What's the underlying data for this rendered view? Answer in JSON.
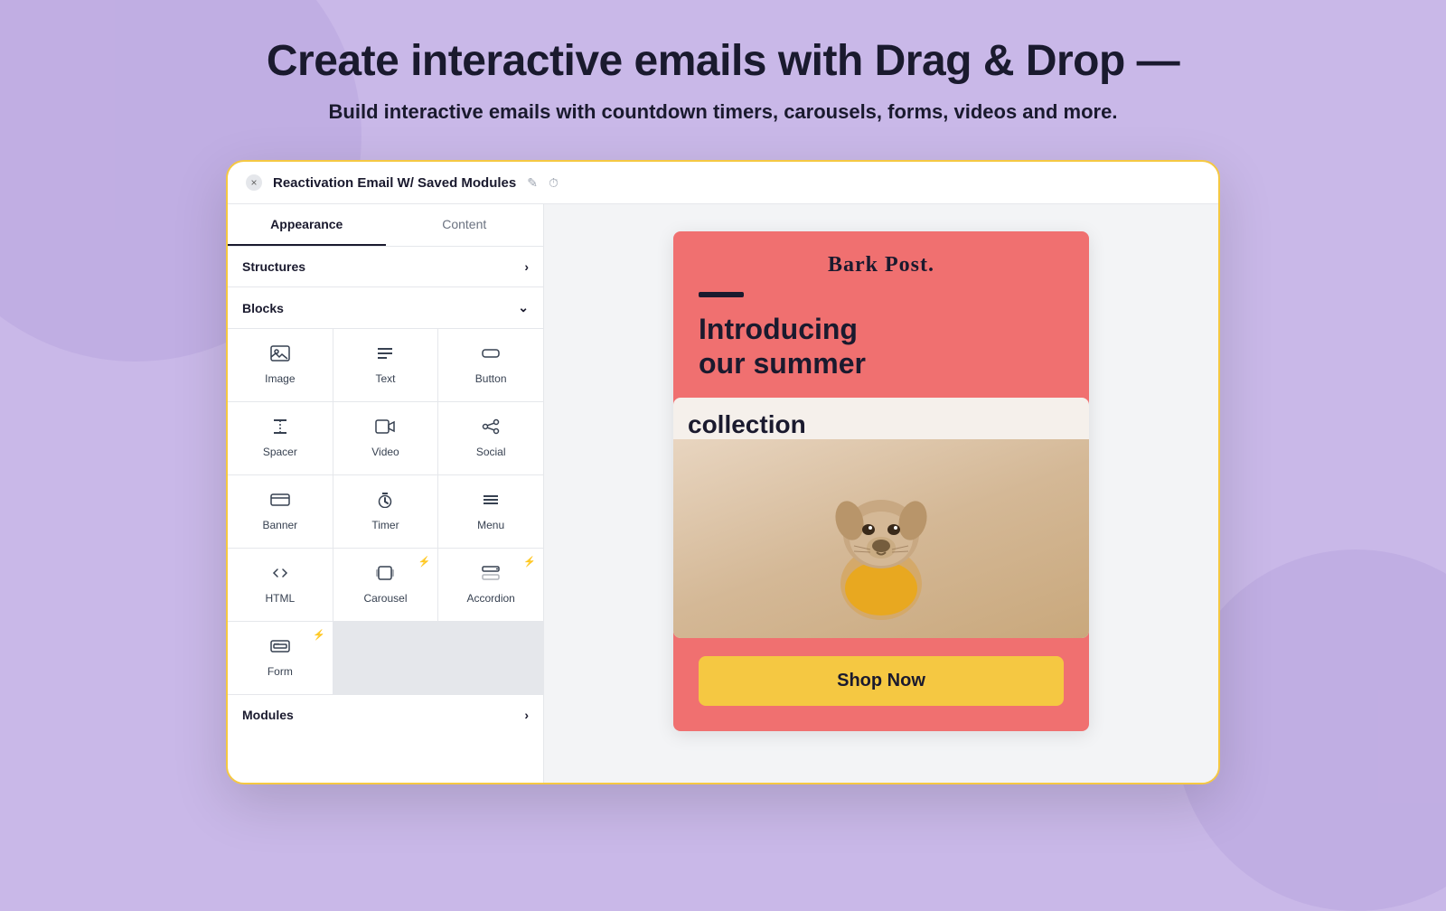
{
  "headline": "Create interactive emails with Drag & Drop —",
  "subheadline": "Build interactive emails with countdown timers, carousels, forms, videos and more.",
  "window": {
    "title": "Reactivation Email W/ Saved Modules",
    "close_label": "×",
    "edit_icon": "✎",
    "history_icon": "⏱"
  },
  "tabs": {
    "appearance": "Appearance",
    "content": "Content"
  },
  "sections": {
    "structures": "Structures",
    "blocks": "Blocks",
    "modules": "Modules"
  },
  "blocks": [
    {
      "id": "image",
      "label": "Image",
      "icon": "🖼",
      "lightning": false
    },
    {
      "id": "text",
      "label": "Text",
      "icon": "≡",
      "lightning": false
    },
    {
      "id": "button",
      "label": "Button",
      "icon": "▭",
      "lightning": false
    },
    {
      "id": "spacer",
      "label": "Spacer",
      "icon": "⊞",
      "lightning": false
    },
    {
      "id": "video",
      "label": "Video",
      "icon": "▶",
      "lightning": false
    },
    {
      "id": "social",
      "label": "Social",
      "icon": "◁",
      "lightning": false
    },
    {
      "id": "banner",
      "label": "Banner",
      "icon": "☰",
      "lightning": false
    },
    {
      "id": "timer",
      "label": "Timer",
      "icon": "⏱",
      "lightning": false
    },
    {
      "id": "menu",
      "label": "Menu",
      "icon": "▬",
      "lightning": false
    },
    {
      "id": "html",
      "label": "HTML",
      "icon": "<>",
      "lightning": false
    },
    {
      "id": "carousel",
      "label": "Carousel",
      "icon": "🖼",
      "lightning": true
    },
    {
      "id": "accordion",
      "label": "Accordion",
      "icon": "≡",
      "lightning": true
    },
    {
      "id": "form",
      "label": "Form",
      "icon": "☑",
      "lightning": true
    }
  ],
  "email_preview": {
    "brand": "Bark Post.",
    "intro_line1": "Introducing",
    "intro_line2": "our summer",
    "card_text": "collection",
    "cta_label": "Shop Now"
  },
  "colors": {
    "bg": "#c9b8e8",
    "window_border": "#f5c842",
    "email_bg": "#f07070",
    "cta_bg": "#f5c842"
  }
}
